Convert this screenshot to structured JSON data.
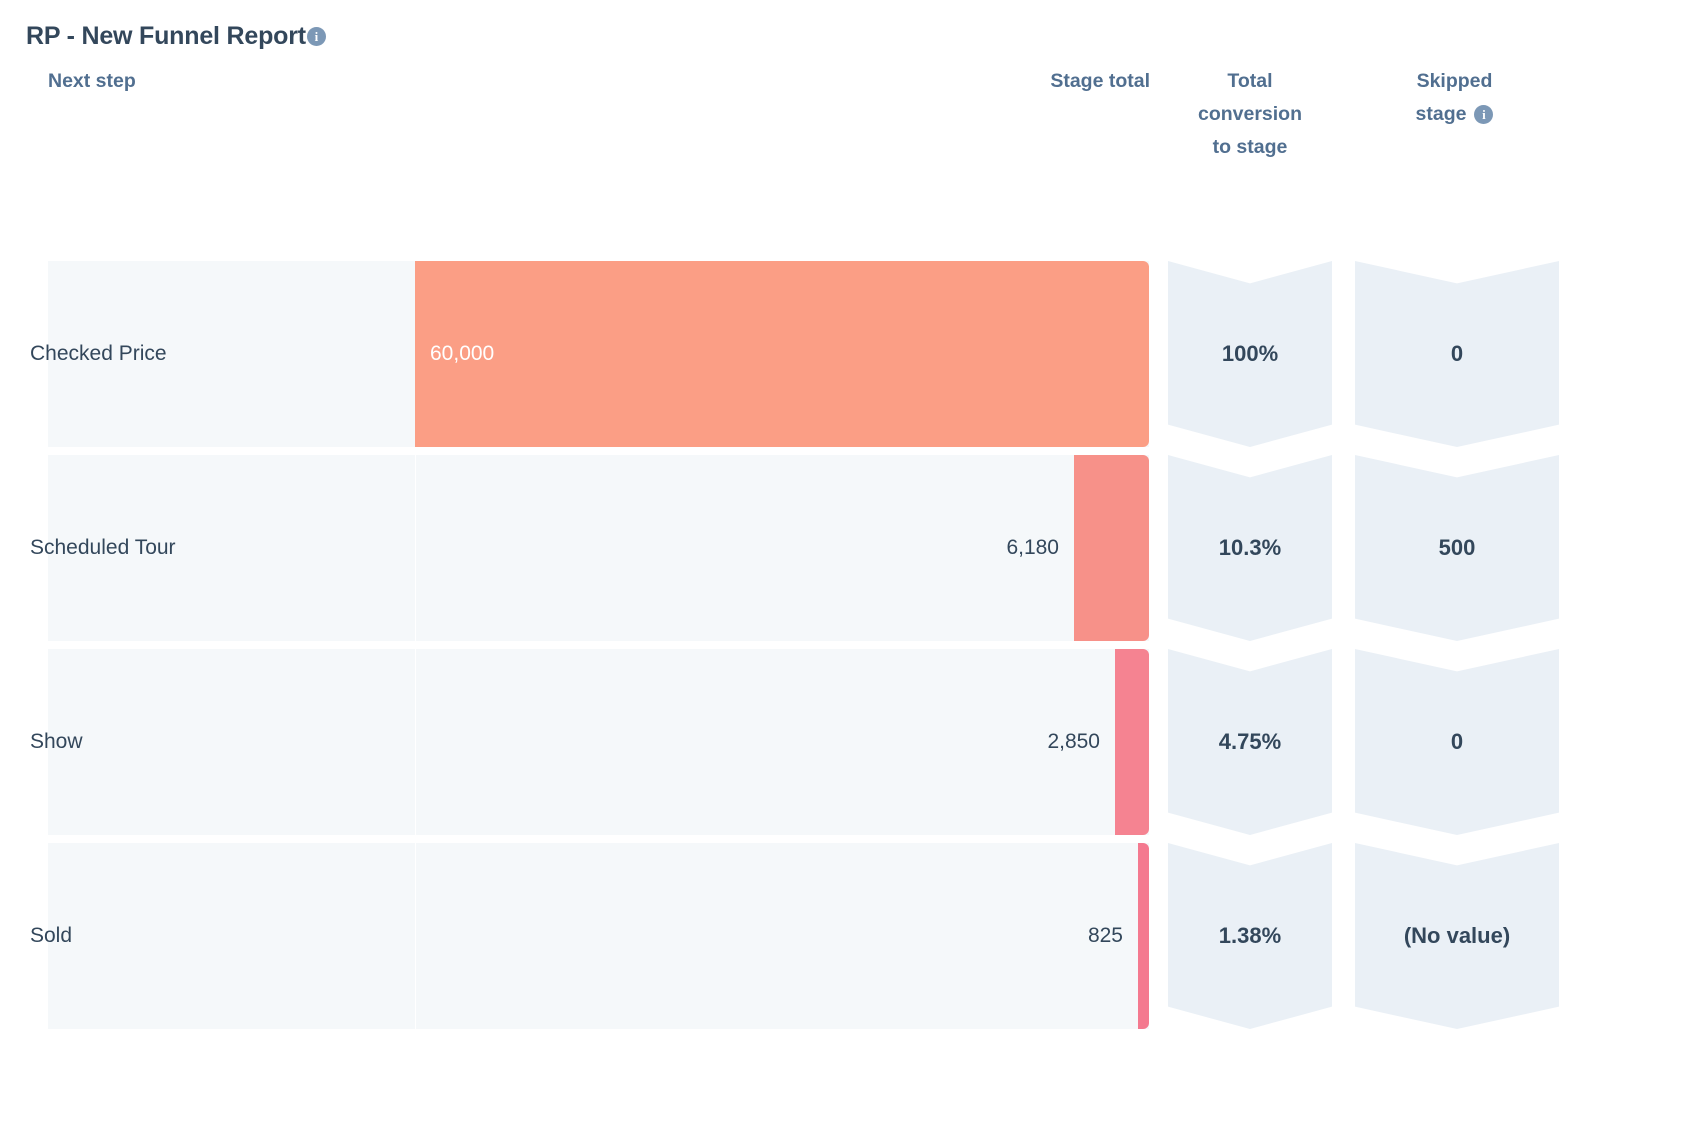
{
  "report": {
    "title": "RP - New Funnel Report",
    "title_info_icon": "info-icon",
    "columns": {
      "next_step": "Next step",
      "stage_total": "Stage total",
      "total_conversion_to_stage": "Total\nconversion\nto stage",
      "total_conversion_line1": "Total",
      "total_conversion_line2": "conversion",
      "total_conversion_line3": "to stage",
      "skipped_stage": "Skipped",
      "skipped_stage_line2": "stage",
      "skipped_stage_info_icon": "info-icon"
    },
    "colors": {
      "bar_stage_1": "#FB9E85",
      "bar_stage_2": "#F79189",
      "bar_stage_3": "#F58391",
      "bar_stage_4": "#F4798F",
      "row_background": "#F5F8FA",
      "metric_cell": "#EAF0F6",
      "header_text": "#516F90",
      "body_text": "#33475B"
    },
    "rows": [
      {
        "stage": "Checked Price",
        "stage_total": "60,000",
        "stage_total_raw": 60000,
        "total_conversion_to_stage": "100%",
        "skipped_stage": "0",
        "bar_color": "#FB9E85",
        "value_inside_bar": true
      },
      {
        "stage": "Scheduled Tour",
        "stage_total": "6,180",
        "stage_total_raw": 6180,
        "total_conversion_to_stage": "10.3%",
        "skipped_stage": "500",
        "bar_color": "#F79189",
        "value_inside_bar": false
      },
      {
        "stage": "Show",
        "stage_total": "2,850",
        "stage_total_raw": 2850,
        "total_conversion_to_stage": "4.75%",
        "skipped_stage": "0",
        "bar_color": "#F58391",
        "value_inside_bar": false
      },
      {
        "stage": "Sold",
        "stage_total": "825",
        "stage_total_raw": 825,
        "total_conversion_to_stage": "1.38%",
        "skipped_stage": "(No value)",
        "bar_color": "#F4798F",
        "value_inside_bar": false
      }
    ]
  },
  "chart_data": {
    "type": "bar",
    "title": "RP - New Funnel Report",
    "xlabel": "",
    "ylabel": "Next step",
    "categories": [
      "Checked Price",
      "Scheduled Tour",
      "Show",
      "Sold"
    ],
    "series": [
      {
        "name": "Stage total",
        "values": [
          60000,
          6180,
          2850,
          825
        ]
      },
      {
        "name": "Total conversion to stage (%)",
        "values": [
          100,
          10.3,
          4.75,
          1.38
        ]
      },
      {
        "name": "Skipped stage",
        "values": [
          0,
          500,
          0,
          null
        ]
      }
    ],
    "value_labels": [
      "60,000",
      "6,180",
      "2,850",
      "825"
    ],
    "conversion_labels": [
      "100%",
      "10.3%",
      "4.75%",
      "1.38%"
    ],
    "skipped_labels": [
      "0",
      "500",
      "0",
      "(No value)"
    ],
    "xlim": [
      0,
      60000
    ],
    "grid": false,
    "legend": "none",
    "orientation": "horizontal-funnel"
  }
}
